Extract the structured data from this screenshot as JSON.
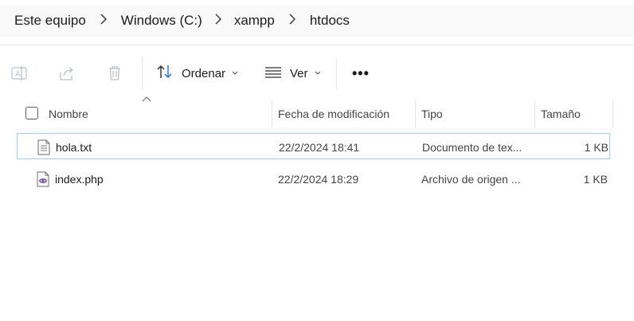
{
  "breadcrumb": {
    "items": [
      "Este equipo",
      "Windows (C:)",
      "xampp",
      "htdocs"
    ]
  },
  "toolbar": {
    "icons": [
      "rename-icon",
      "share-icon",
      "delete-icon"
    ],
    "sort_label": "Ordenar",
    "view_label": "Ver",
    "more_label": "•••"
  },
  "columns": {
    "name": "Nombre",
    "date": "Fecha de modificación",
    "type": "Tipo",
    "size": "Tamaño"
  },
  "files": [
    {
      "name": "hola.txt",
      "date": "22/2/2024 18:41",
      "type": "Documento de tex...",
      "size": "1 KB",
      "icon": "text-file-icon",
      "selected": true
    },
    {
      "name": "index.php",
      "date": "22/2/2024 18:29",
      "type": "Archivo de origen ...",
      "size": "1 KB",
      "icon": "php-file-icon",
      "selected": false
    }
  ],
  "colors": {
    "selection_border": "#99d1ef",
    "breadcrumb_bg": "#f9f9f9",
    "php_purple": "#7b5ea7"
  }
}
